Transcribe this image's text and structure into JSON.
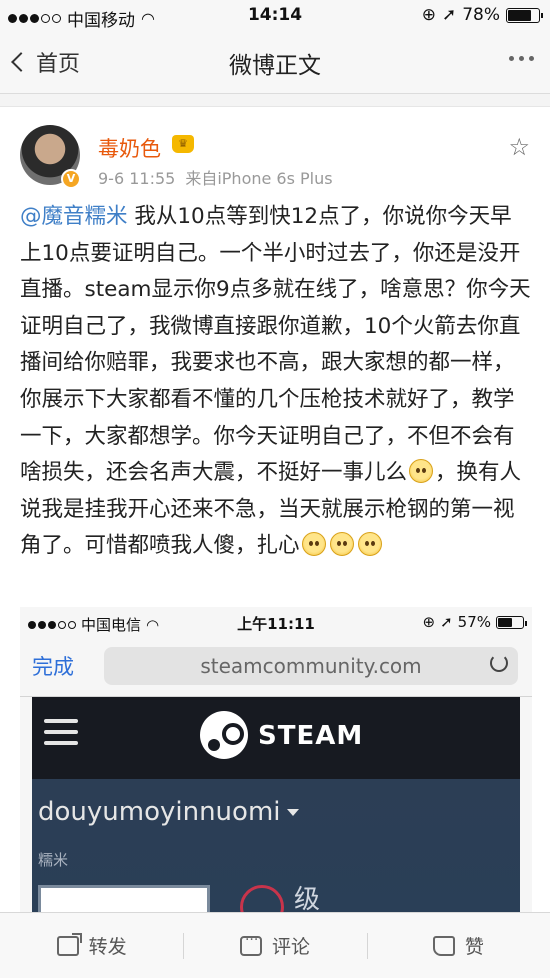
{
  "status_bar": {
    "carrier": "中国移动",
    "time": "14:14",
    "battery": "78%",
    "battery_level": 0.78
  },
  "nav": {
    "back_label": "首页",
    "title": "微博正文"
  },
  "post": {
    "username": "毒奶色",
    "date": "9-6 11:55",
    "source": "来自iPhone 6s Plus",
    "mention": "@魔音糯米",
    "text_1": " 我从10点等到快12点了，你说你今天早上10点要证明自己。一个半小时过去了，你还是没开直播。steam显示你9点多就在线了，啥意思？你今天证明自己了，我微博直接跟你道歉，10个火箭去你直播间给你赔罪，我要求也不高，跟大家想的都一样，你展示下大家都看不懂的几个压枪技术就好了，教学一下，大家都想学。你今天证明自己了，不但不会有啥损失，还会名声大震，不挺好一事儿么",
    "text_2": "，换有人说我是挂我开心还来不急，当天就展示枪钢的第一视角了。可惜都喷我人傻，扎心"
  },
  "screenshot": {
    "carrier": "中国电信",
    "time": "上午11:11",
    "battery": "57%",
    "battery_level": 0.57,
    "done_label": "完成",
    "url": "steamcommunity.com",
    "brand": "STEAM",
    "profile_name": "douyumoyinnuomi",
    "profile_alias": "糯米",
    "level_partial": "级"
  },
  "toolbar": {
    "repost": "转发",
    "comment": "评论",
    "like": "赞"
  }
}
